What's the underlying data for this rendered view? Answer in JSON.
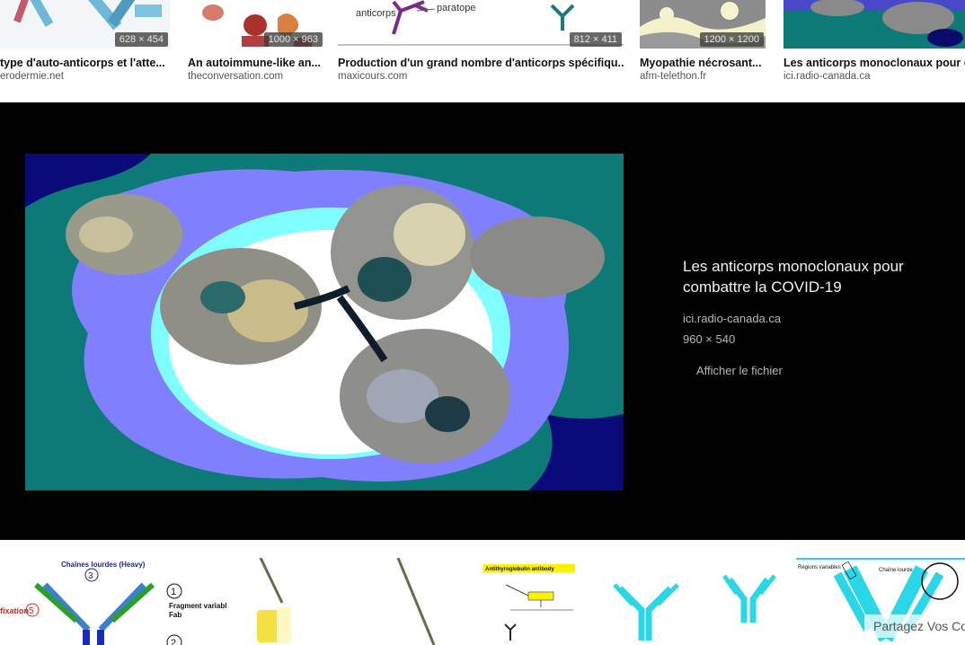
{
  "top_results": [
    {
      "title": "type d'auto-anticorps et l'atte...",
      "source": "erodermie.net",
      "dimensions": "628 × 454"
    },
    {
      "title": "An autoimmune-like an...",
      "source": "theconversation.com",
      "dimensions": "1000 × 963"
    },
    {
      "title": "Production d'un grand nombre d'anticorps spécifiqu...",
      "source": "maxicours.com",
      "dimensions": "812 × 411"
    },
    {
      "title": "Myopathie nécrosant...",
      "source": "afm-telethon.fr",
      "dimensions": "1200 × 1200"
    },
    {
      "title": "Les anticorps monoclonaux pour c",
      "source": "ici.radio-canada.ca",
      "dimensions": ""
    }
  ],
  "thumb_text": {
    "anticorps": "anticorps",
    "paratope": "paratope"
  },
  "viewer": {
    "title": "Les anticorps monoclonaux pour combattre la COVID-19",
    "source": "ici.radio-canada.ca",
    "dimensions": "960 × 540",
    "open_file_label": "Afficher le fichier"
  },
  "bottom_thumb_text": {
    "heavy_chain": "Chaînes lourdes (Heavy)",
    "fragment": "Fragment variable",
    "fab": "Fab",
    "fixation": "fixation",
    "num_1": "1",
    "num_2": "2",
    "num_3": "3",
    "num_5": "5",
    "antithyroid": "Antithyroglobulin antibody",
    "regions": "Régions variables",
    "chaine_lourde": "Chaîne lourde"
  },
  "share_overlay": "Partagez Vos Co",
  "colors": {
    "viewer_bg": "#000000",
    "preview_teal": "#0e7a78",
    "preview_periwinkle": "#8080ff",
    "preview_cyan": "#7fffff",
    "antibody_cyan": "#29d7e6"
  }
}
